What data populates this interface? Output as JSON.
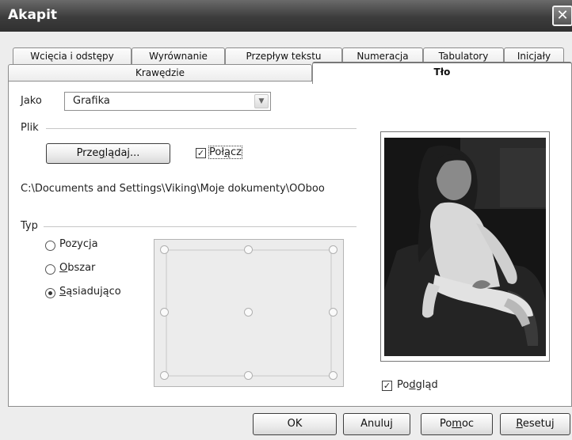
{
  "window": {
    "title": "Akapit",
    "close_glyph": "✕"
  },
  "tabs_row1": [
    "Wcięcia i odstępy",
    "Wyrównanie",
    "Przepływ tekstu",
    "Numeracja",
    "Tabulatory",
    "Inicjały"
  ],
  "tabs_row2": [
    "Krawędzie",
    "Tło"
  ],
  "active_tab": "Tło",
  "as": {
    "label": "Jako",
    "value": "Grafika",
    "arrow_glyph": "▼"
  },
  "file": {
    "group_label": "Plik",
    "browse_label": "Przeglądaj...",
    "link_label": "Połącz",
    "link_checked": true,
    "path": "C:\\Documents and Settings\\Viking\\Moje dokumenty\\OOboo"
  },
  "type": {
    "group_label": "Typ",
    "options": [
      "Pozycja",
      "Obszar",
      "Sąsiadująco"
    ],
    "selected": "Sąsiadująco"
  },
  "preview": {
    "label": "Podgląd",
    "checked": true,
    "check_glyph": "✓"
  },
  "footer": {
    "ok": "OK",
    "cancel": "Anuluj",
    "help": "Pomoc",
    "reset": "Resetuj"
  }
}
